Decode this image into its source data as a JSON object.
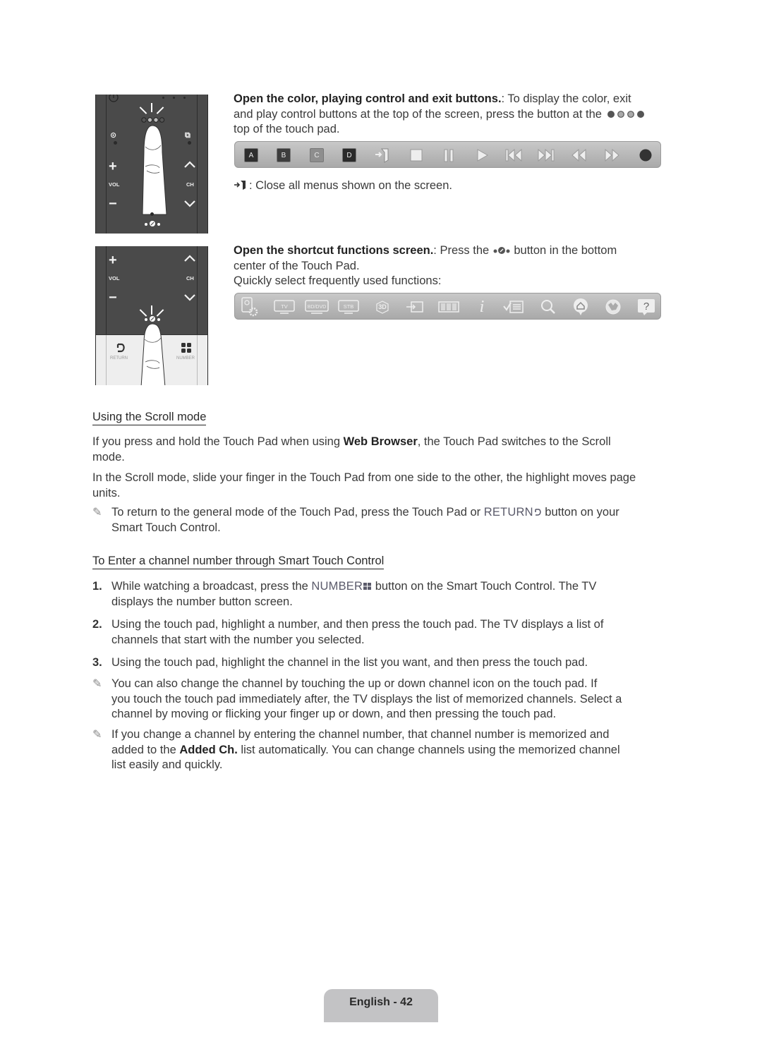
{
  "remote_top": {
    "labels": {
      "vol": "VOL",
      "ch": "CH"
    },
    "icons": [
      "power-icon",
      "history-icon",
      "source-icon",
      "plus-icon",
      "minus-icon",
      "chevron-up-icon",
      "chevron-down-icon",
      "shortcut-icon",
      "color-dots-icon"
    ]
  },
  "remote_bottom": {
    "labels": {
      "vol": "VOL",
      "ch": "CH",
      "return": "RETURN",
      "number": "NUMBER"
    }
  },
  "section1": {
    "title": "Open the color, playing control and exit buttons.",
    "sep": ":",
    "line1_rest": " To display the color, exit",
    "line2": "and play control buttons at the top of the screen, press the button at the",
    "line3": "top of the touch pad.",
    "toolbar": {
      "items": [
        {
          "type": "color",
          "label": "A",
          "color": "#2e2e2e"
        },
        {
          "type": "color",
          "label": "B",
          "color": "#3d3d3d"
        },
        {
          "type": "color",
          "label": "C",
          "color": "#8e8e8e"
        },
        {
          "type": "color",
          "label": "D",
          "color": "#2a2a2a"
        },
        {
          "type": "icon",
          "name": "exit-icon"
        },
        {
          "type": "icon",
          "name": "stop-icon"
        },
        {
          "type": "icon",
          "name": "pause-icon"
        },
        {
          "type": "icon",
          "name": "play-icon"
        },
        {
          "type": "icon",
          "name": "previous-icon"
        },
        {
          "type": "icon",
          "name": "next-icon"
        },
        {
          "type": "icon",
          "name": "rewind-icon"
        },
        {
          "type": "icon",
          "name": "fast-forward-icon"
        },
        {
          "type": "icon",
          "name": "record-icon"
        }
      ]
    },
    "exit_note": ": Close all menus shown on the screen."
  },
  "section2": {
    "title": "Open the shortcut functions screen.",
    "sep": ":",
    "line1_a": " Press the ",
    "line1_b": " button in the bottom",
    "line2": "center of the Touch Pad.",
    "line3": "Quickly select frequently used functions:",
    "toolbar": {
      "items": [
        {
          "name": "settings-power-icon",
          "label": ""
        },
        {
          "name": "tv-icon",
          "label": "TV"
        },
        {
          "name": "bd-dvd-icon",
          "label": "BD/DVD"
        },
        {
          "name": "stb-icon",
          "label": "STB"
        },
        {
          "name": "3d-icon",
          "label": "3D"
        },
        {
          "name": "source-input-icon",
          "label": ""
        },
        {
          "name": "multi-view-icon",
          "label": ""
        },
        {
          "name": "info-icon",
          "label": "i"
        },
        {
          "name": "channel-list-icon",
          "label": ""
        },
        {
          "name": "search-icon",
          "label": ""
        },
        {
          "name": "smart-hub-icon",
          "label": ""
        },
        {
          "name": "web-browser-icon",
          "label": ""
        },
        {
          "name": "help-icon",
          "label": "?"
        }
      ]
    }
  },
  "scroll": {
    "heading": "Using the Scroll mode",
    "p1_a": "If you press and hold the Touch Pad when using ",
    "p1_bold": "Web Browser",
    "p1_b": ", the Touch Pad switches to the Scroll",
    "p1_line2": "mode.",
    "p2_line1": "In the Scroll mode, slide your finger in the Touch Pad from one side to the other, the highlight moves page",
    "p2_line2": "units.",
    "note_a": "To return to the general mode of the Touch Pad, press the Touch Pad or ",
    "note_btn": "RETURN",
    "note_b": " button on your",
    "note_line2": "Smart Touch Control."
  },
  "channel": {
    "heading": "To Enter a channel number through Smart Touch Control",
    "steps": [
      {
        "num": "1.",
        "line1_a": "While watching a broadcast, press the ",
        "btn": "NUMBER",
        "line1_b": " button on the Smart Touch Control. The TV",
        "line2": "displays the number button screen."
      },
      {
        "num": "2.",
        "line1": "Using the touch pad, highlight a number, and then press the touch pad. The TV displays a list of",
        "line2": "channels that start with the number you selected."
      },
      {
        "num": "3.",
        "line1": "Using the touch pad, highlight the channel in the list you want, and then press the touch pad."
      }
    ],
    "note1": {
      "line1": "You can also change the channel by touching the up or down channel icon on the touch pad. If",
      "line2": "you touch the touch pad immediately after, the TV displays the list of memorized channels. Select a",
      "line3": "channel by moving or flicking your finger up or down, and then pressing the touch pad."
    },
    "note2": {
      "line1": "If you change a channel by entering the channel number, that channel number is memorized and",
      "line2_a": "added to the ",
      "line2_bold": "Added Ch.",
      "line2_b": " list automatically. You can change channels using the memorized channel",
      "line3": "list easily and quickly."
    }
  },
  "footer": {
    "page_label": "English - 42"
  },
  "glyphs": {
    "note": "✎"
  }
}
